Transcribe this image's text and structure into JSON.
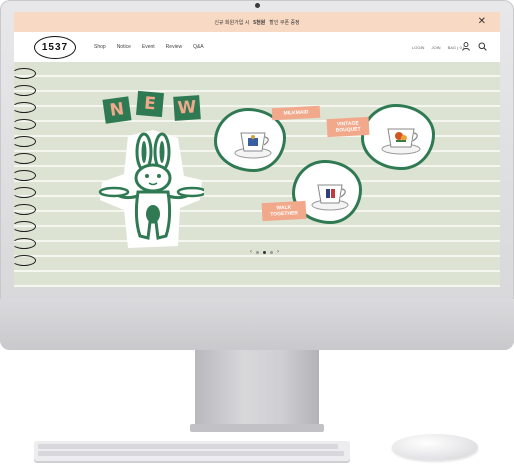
{
  "banner": {
    "prefix": "신규 회원가입 시",
    "highlight": "5천원",
    "suffix": "할인 쿠폰 증정",
    "close_icon": "close-icon"
  },
  "header": {
    "logo_text": "1537",
    "nav": [
      "Shop",
      "Notice",
      "Event",
      "Review",
      "Q&A"
    ],
    "util_links": [
      "LOGIN",
      "JOIN",
      "BAG ( 0 )"
    ],
    "icons": [
      "user-icon",
      "search-icon"
    ]
  },
  "hero": {
    "new_letters": [
      "N",
      "E",
      "W"
    ],
    "tags": [
      "MILKMAID",
      "VINTAGE BOUQUET",
      "WALK TOGETHER"
    ],
    "slide_prev": "‹",
    "slide_next": "›",
    "slide_count": 3,
    "active_slide": 2
  },
  "colors": {
    "banner": "#f8d9c3",
    "hero_bg": "#dde3d3",
    "accent_green": "#2f7a52",
    "tag_salmon": "#f2a98b"
  }
}
